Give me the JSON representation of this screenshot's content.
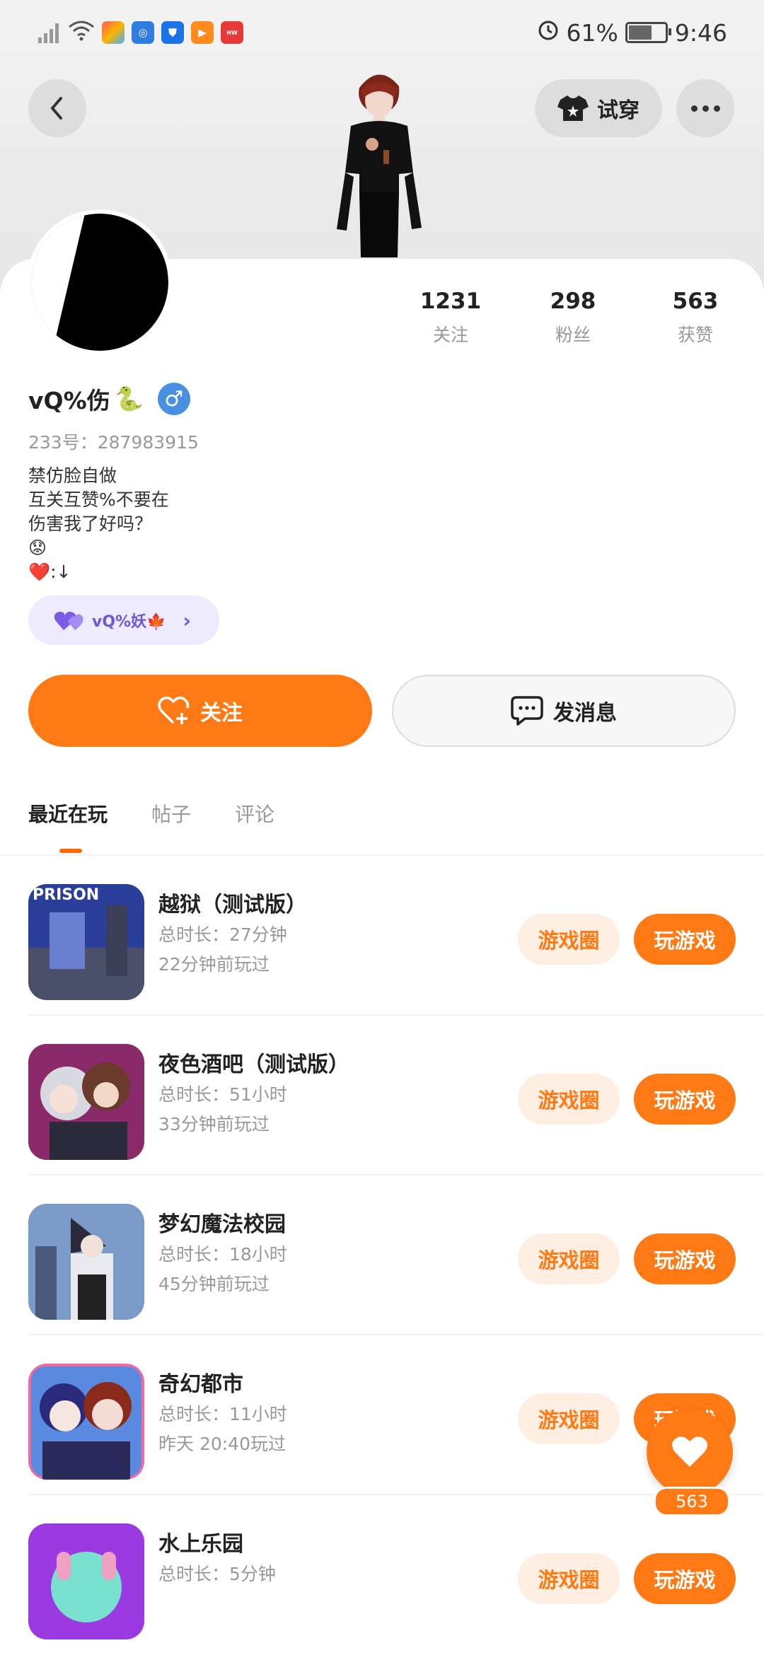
{
  "status_bar": {
    "battery": "61%",
    "time": "9:46",
    "icons": [
      "signal-icon",
      "wifi-icon",
      "app-icon-1",
      "app-icon-2",
      "app-icon-3",
      "app-icon-4",
      "huawei-app-icon",
      "alarm-icon",
      "battery-icon"
    ]
  },
  "header": {
    "try_on_label": "试穿"
  },
  "profile": {
    "stats": [
      {
        "value": "1231",
        "label": "关注"
      },
      {
        "value": "298",
        "label": "粉丝"
      },
      {
        "value": "563",
        "label": "获赞"
      }
    ],
    "username": "vQ%伤",
    "username_emoji": "🐍",
    "gender_symbol": "♂",
    "id_text": "233号：287983915",
    "bio_lines": [
      "禁仿脸自做",
      "互关互赞%不要在",
      "伤害我了好吗？",
      "😟",
      "❤️:↓"
    ],
    "cp_name": "vQ%妖🍁"
  },
  "actions": {
    "follow_label": "关注",
    "message_label": "发消息"
  },
  "tabs": [
    "最近在玩",
    "帖子",
    "评论"
  ],
  "games": [
    {
      "name": "越狱（测试版）",
      "total": "总时长：27分钟",
      "last": "22分钟前玩过",
      "thumb_text": "PRISON"
    },
    {
      "name": "夜色酒吧（测试版）",
      "total": "总时长：51小时",
      "last": "33分钟前玩过",
      "thumb_text": ""
    },
    {
      "name": "梦幻魔法校园",
      "total": "总时长：18小时",
      "last": "45分钟前玩过",
      "thumb_text": ""
    },
    {
      "name": "奇幻都市",
      "total": "总时长：11小时",
      "last": "昨天 20:40玩过",
      "thumb_text": ""
    },
    {
      "name": "水上乐园",
      "total": "总时长：5分钟",
      "last": "",
      "thumb_text": ""
    }
  ],
  "game_buttons": {
    "circle": "游戏圈",
    "play": "玩游戏"
  },
  "fab": {
    "count": "563"
  },
  "colors": {
    "accent": "#ff7a14",
    "accent_light": "#ffeee2",
    "cp_chip": "#eeeaff",
    "gender": "#4a90e2"
  }
}
